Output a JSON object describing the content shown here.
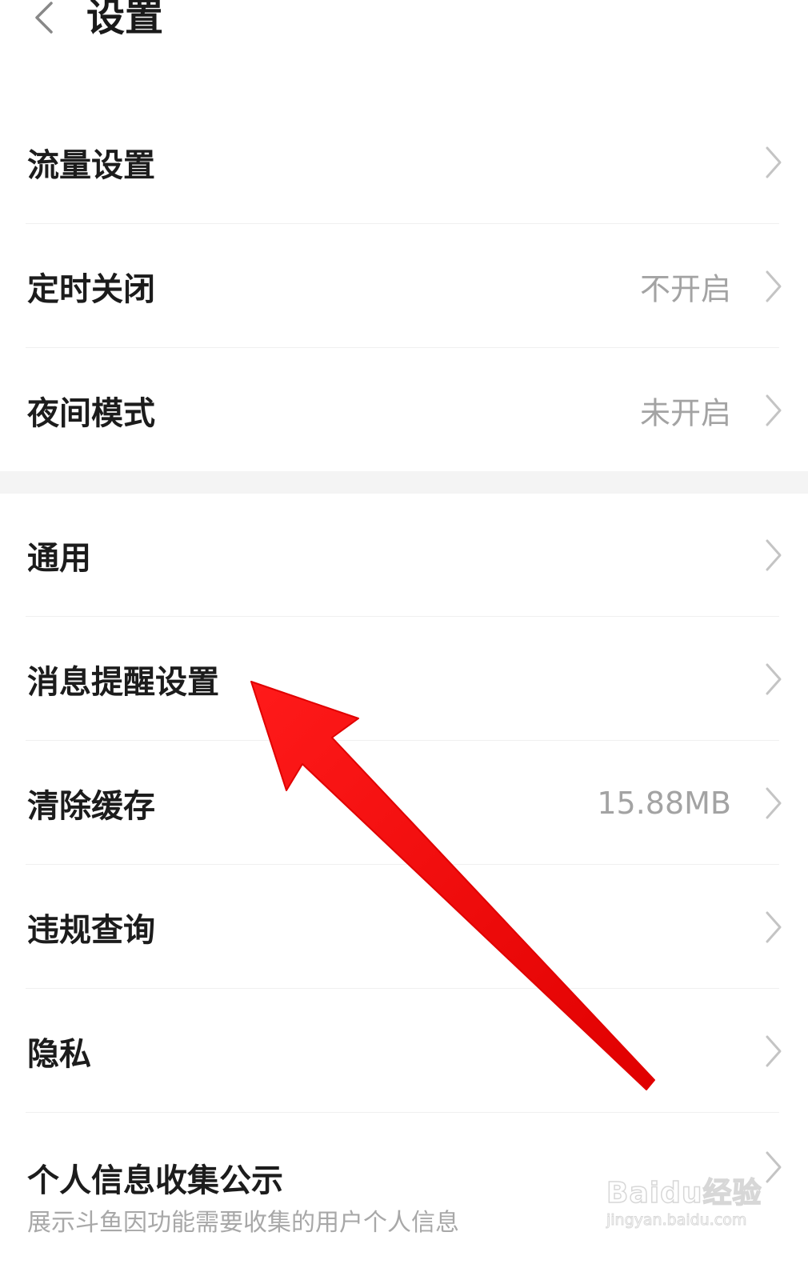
{
  "header": {
    "title": "设置",
    "back_icon": "chevron-left-icon"
  },
  "group1": [
    {
      "label": "流量设置",
      "value": ""
    },
    {
      "label": "定时关闭",
      "value": "不开启"
    },
    {
      "label": "夜间模式",
      "value": "未开启"
    }
  ],
  "group2": [
    {
      "label": "通用",
      "value": ""
    },
    {
      "label": "消息提醒设置",
      "value": ""
    },
    {
      "label": "清除缓存",
      "value": "15.88MB"
    },
    {
      "label": "违规查询",
      "value": ""
    },
    {
      "label": "隐私",
      "value": ""
    },
    {
      "label": "个人信息收集公示",
      "sublabel": "展示斗鱼因功能需要收集的用户个人信息",
      "value": ""
    }
  ],
  "annotation": {
    "arrow_color": "#f50a0a"
  },
  "watermark": {
    "brand": "Baidu经验",
    "url": "jingyan.baidu.com"
  },
  "colors": {
    "text_primary": "#1c1c1c",
    "text_secondary": "#a3a3a3",
    "divider": "#f0f0f0",
    "section_gap": "#f4f4f4"
  }
}
